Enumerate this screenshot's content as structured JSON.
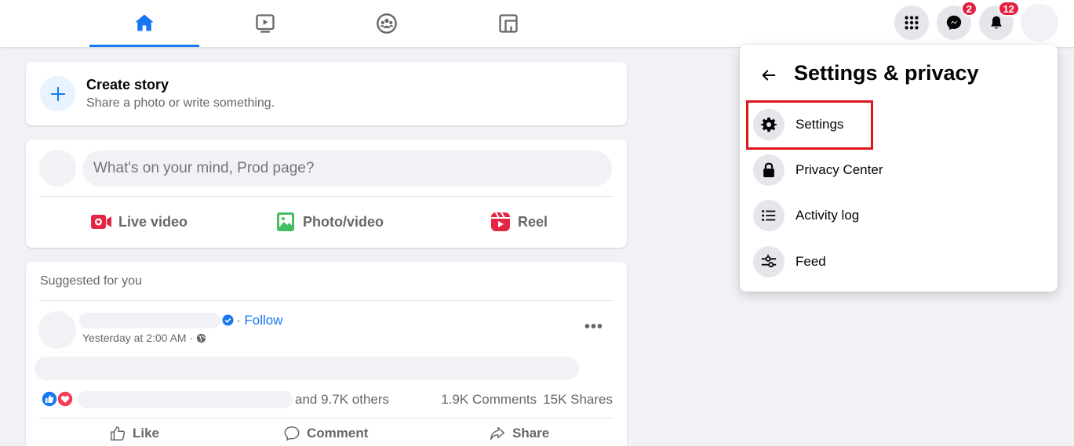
{
  "topbar": {
    "tabs": [
      {
        "name": "home",
        "active": true
      },
      {
        "name": "watch",
        "active": false
      },
      {
        "name": "groups",
        "active": false
      },
      {
        "name": "gaming",
        "active": false
      }
    ],
    "menu_icon": "grid-menu-icon",
    "messenger_badge": "2",
    "notifications_badge": "12",
    "accent_color": "#1877f2"
  },
  "story": {
    "title": "Create story",
    "subtitle": "Share a photo or write something."
  },
  "composer": {
    "placeholder": "What's on your mind, Prod page?",
    "actions": {
      "live": "Live video",
      "photo": "Photo/video",
      "reel": "Reel"
    }
  },
  "feed": {
    "suggested_label": "Suggested for you",
    "follow_dot": "·",
    "follow_label": "Follow",
    "timestamp": "Yesterday at 2:00 AM ·",
    "more": "•••",
    "reactions_others": "and 9.7K others",
    "comments_count": "1.9K Comments",
    "shares_count": "15K Shares",
    "actions": {
      "like": "Like",
      "comment": "Comment",
      "share": "Share"
    }
  },
  "settings_menu": {
    "title": "Settings & privacy",
    "items": [
      {
        "label": "Settings",
        "icon": "gear-icon"
      },
      {
        "label": "Privacy Center",
        "icon": "lock-icon"
      },
      {
        "label": "Activity log",
        "icon": "list-icon"
      },
      {
        "label": "Feed",
        "icon": "sliders-icon"
      }
    ],
    "highlight_color": "#e0161f"
  }
}
